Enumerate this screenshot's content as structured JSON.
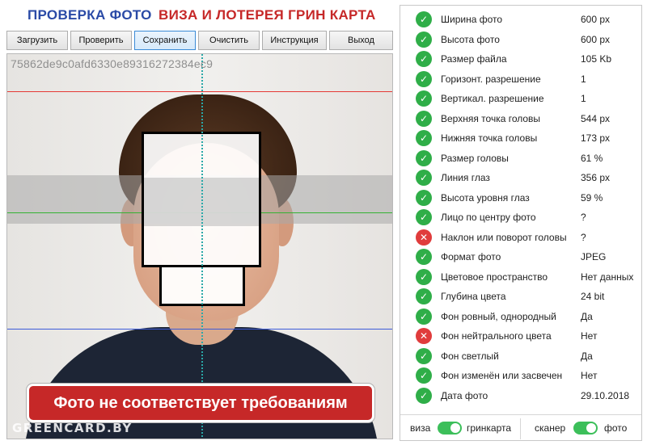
{
  "header": {
    "title_left": "ПРОВЕРКА ФОТО",
    "title_right": "ВИЗА И ЛОТЕРЕЯ ГРИН КАРТА"
  },
  "toolbar": {
    "buttons": [
      "Загрузить",
      "Проверить",
      "Сохранить",
      "Очистить",
      "Инструкция",
      "Выход"
    ],
    "active": "Сохранить"
  },
  "photo": {
    "hash": "75862de9c0afd6330e89316272384ec9",
    "result_message": "Фото не соответствует требованиям",
    "watermark": "GREENCARD.BY"
  },
  "checks": [
    {
      "status": "ok",
      "label": "Ширина фото",
      "value": "600 px"
    },
    {
      "status": "ok",
      "label": "Высота фото",
      "value": "600 px"
    },
    {
      "status": "ok",
      "label": "Размер файла",
      "value": "105 Kb"
    },
    {
      "status": "ok",
      "label": "Горизонт. разрешение",
      "value": "1"
    },
    {
      "status": "ok",
      "label": "Вертикал. разрешение",
      "value": "1"
    },
    {
      "status": "ok",
      "label": "Верхняя точка головы",
      "value": "544 px"
    },
    {
      "status": "ok",
      "label": "Нижняя точка головы",
      "value": "173 px"
    },
    {
      "status": "ok",
      "label": "Размер головы",
      "value": "61 %"
    },
    {
      "status": "ok",
      "label": "Линия глаз",
      "value": "356 px"
    },
    {
      "status": "ok",
      "label": "Высота уровня глаз",
      "value": "59 %"
    },
    {
      "status": "ok",
      "label": "Лицо по центру фото",
      "value": "?"
    },
    {
      "status": "bad",
      "label": "Наклон или поворот головы",
      "value": "?"
    },
    {
      "status": "ok",
      "label": "Формат фото",
      "value": "JPEG"
    },
    {
      "status": "ok",
      "label": "Цветовое пространство",
      "value": "Нет данных"
    },
    {
      "status": "ok",
      "label": "Глубина цвета",
      "value": "24 bit"
    },
    {
      "status": "ok",
      "label": "Фон ровный, однородный",
      "value": "Да"
    },
    {
      "status": "bad",
      "label": "Фон нейтрального цвета",
      "value": "Нет"
    },
    {
      "status": "ok",
      "label": "Фон светлый",
      "value": "Да"
    },
    {
      "status": "ok",
      "label": "Фон изменён или засвечен",
      "value": "Нет"
    },
    {
      "status": "ok",
      "label": "Дата фото",
      "value": "29.10.2018"
    }
  ],
  "icons": {
    "ok": "check-circle-icon",
    "bad": "cross-circle-icon"
  },
  "switches": {
    "left": {
      "off_label": "виза",
      "on_label": "гринкарта",
      "state": "on"
    },
    "right": {
      "off_label": "сканер",
      "on_label": "фото",
      "state": "on"
    }
  },
  "colors": {
    "title_blue": "#2a4aa6",
    "title_red": "#c62828",
    "ok": "#2fae48",
    "bad": "#e03c3c",
    "toggle_on": "#3cbf5a",
    "alert": "#c62828"
  }
}
